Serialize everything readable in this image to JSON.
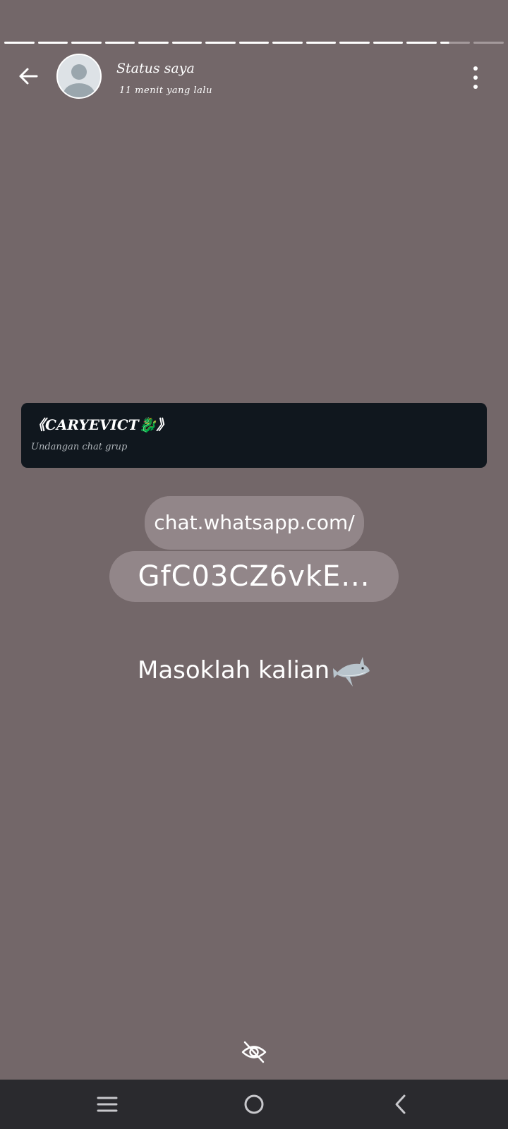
{
  "header": {
    "title": "Status saya",
    "subtitle": "11 menit yang lalu",
    "progress_segments": 15
  },
  "invite": {
    "group_name": "《CARYEVICT🐉》",
    "subtitle": "Undangan chat grup"
  },
  "link": {
    "line1": "chat.whatsapp.com/",
    "line2": "GfC03CZ6vkE..."
  },
  "caption": {
    "text": "Masoklah kalian"
  },
  "icons": {
    "back": "arrow-left-icon",
    "avatar": "default-avatar-icon",
    "menu": "more-vertical-icon",
    "shark": "shark-emoji-icon",
    "visibility": "eye-off-icon",
    "nav_recents": "recents-icon",
    "nav_home": "home-icon",
    "nav_back": "nav-back-icon"
  },
  "colors": {
    "background": "#736769",
    "card": "#10171e",
    "pill": "#928689",
    "navbar": "#2a2a2e"
  }
}
